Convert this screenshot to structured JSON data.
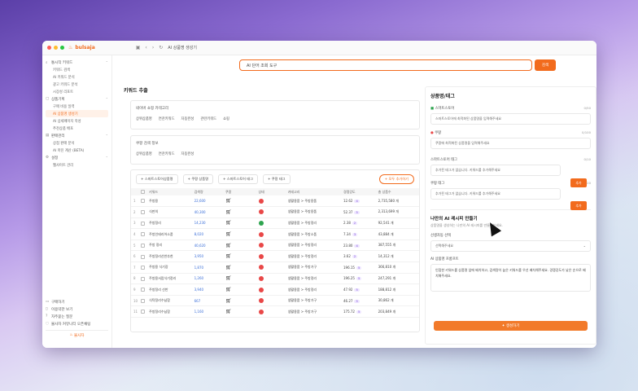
{
  "window": {
    "logo": "bulsaja",
    "tab_title": "AI 상품명 생성기"
  },
  "sidebar": {
    "sections": [
      {
        "label": "통시작 키워드",
        "items": [
          "키워드 검색",
          "AI 키워드 분석",
          "광고 키워드 분석",
          "시장성 리포트"
        ]
      },
      {
        "label": "상품기획",
        "items": [
          "구매 비용 일력",
          "AI 상품명 생성기",
          "AI 상세페이지 작성",
          "추천상품 배포"
        ]
      },
      {
        "label": "판매관리",
        "items": [
          "상점 판매 분석",
          "AI 마진 계산 (BETA)"
        ]
      },
      {
        "label": "설정",
        "items": [
          "웹사이트 관리"
        ]
      }
    ],
    "active_item": "AI 상품명 생성기",
    "bottom_items": [
      "구매하기",
      "이용약관 보기",
      "자주묻는 질문",
      "불사자 커뮤니티 오픈채팅"
    ],
    "brand": "불사자"
  },
  "search": {
    "value": "AI 단어 조회 도구",
    "button": "검색"
  },
  "left": {
    "title": "키워드 추출",
    "card1": {
      "label": "네이버 쇼핑 카테고리",
      "chips": [
        "상위상품명",
        "연관키워드",
        "자동완성",
        "관련키워드",
        "쇼핑"
      ]
    },
    "card2": {
      "label": "쿠팡 검색 정보",
      "chips": [
        "상위상품명",
        "연관키워드",
        "자동완성"
      ]
    },
    "actions": [
      "+ 스마트스토어상품명",
      "+ 쿠팡 상품명",
      "+ 스마트스토어 태그",
      "+ 쿠팡 태그"
    ],
    "apply_button": "+ 모두 추가하기",
    "columns": [
      "키워드",
      "검색량",
      "쿠팡",
      "상태",
      "카테고리",
      "경쟁강도",
      "총 상품수"
    ],
    "rows": [
      {
        "num": "1",
        "keyword": "주방용",
        "volume": "22,600",
        "cat": "생활용품 > 주방용품",
        "comp": "12.62",
        "level": "4",
        "total": "2,735,580 개",
        "ok": false
      },
      {
        "num": "2",
        "keyword": "식판의",
        "volume": "40,300",
        "cat": "생활용품 > 주방용품",
        "comp": "52.37",
        "level": "5",
        "total": "2,313,699 개",
        "ok": false
      },
      {
        "num": "3",
        "keyword": "주방정리",
        "volume": "14,230",
        "cat": "생활용품 > 주방정리",
        "comp": "2.38",
        "level": "2",
        "total": "92,541 개",
        "ok": true
      },
      {
        "num": "4",
        "keyword": "주방인테리어소품",
        "volume": "8,020",
        "cat": "생활용품 > 주방소품",
        "comp": "7.34",
        "level": "3",
        "total": "43,884 개",
        "ok": false
      },
      {
        "num": "5",
        "keyword": "주방 정리",
        "volume": "40,620",
        "cat": "생활용품 > 주방정리",
        "comp": "23.80",
        "level": "4",
        "total": "387,555 개",
        "ok": false
      },
      {
        "num": "6",
        "keyword": "주방정리선반추천",
        "volume": "3,950",
        "cat": "생활용품 > 주방정리",
        "comp": "3.62",
        "level": "2",
        "total": "14,312 개",
        "ok": false
      },
      {
        "num": "7",
        "keyword": "주방용 식기장",
        "volume": "1,870",
        "cat": "생활용품 > 주방가구",
        "comp": "196.15",
        "level": "5",
        "total": "366,810 개",
        "ok": false
      },
      {
        "num": "8",
        "keyword": "주방용서랍식기정리",
        "volume": "1,260",
        "cat": "생활용품 > 주방정리",
        "comp": "196.25",
        "level": "5",
        "total": "247,291 개",
        "ok": false
      },
      {
        "num": "9",
        "keyword": "주방정리 선반",
        "volume": "3,940",
        "cat": "생활용품 > 주방정리",
        "comp": "47.92",
        "level": "5",
        "total": "188,812 개",
        "ok": false
      },
      {
        "num": "10",
        "keyword": "식탁정리수납함",
        "volume": "667",
        "cat": "생활용품 > 주방가구",
        "comp": "46.27",
        "level": "5",
        "total": "30,862 개",
        "ok": false
      },
      {
        "num": "11",
        "keyword": "주방정리수납함",
        "volume": "1,160",
        "cat": "생활용품 > 주방가구",
        "comp": "175.72",
        "level": "5",
        "total": "203,849 개",
        "ok": false
      }
    ]
  },
  "right": {
    "title": "상품명/태그",
    "smartstore_label": "스마트스토어",
    "smartstore_hint": "스마트스토어에 최적화된 상품명을 입력해주세요",
    "smartstore_count": "0/50",
    "coupang_label": "쿠팡",
    "coupang_hint": "쿠팡에 최적화된 상품명을 입력해주세요",
    "coupang_count": "0/100",
    "ss_tag_label": "스마트스토어 태그",
    "ss_tag_hint": "추가된 태그가 없습니다. 키워드를 추가해주세요",
    "ss_tag_count": "0/10",
    "cp_tag_label": "쿠팡 태그",
    "cp_tag_hint": "추가된 태그가 없습니다. 키워드를 추가해주세요",
    "cp_tag_count": "0/20",
    "add_label": "추가",
    "ai_title": "나만의 AI 레시피 만들기",
    "ai_desc": "상품명을 생성하는 나만의 AI 레시피를 만들어보세요.",
    "select_label": "선생자동 선택",
    "select_placeholder": "선택해주세요",
    "prompt_label": "AI 상품명 프롬프트",
    "prompt_text": "인접한 키워드를 상품명 앞에 배치하고, 검색량이 높은 키워드를 우선 배치해주세요. 경쟁강도가 낮은 순으로 배치해주세요.",
    "generate_button": "생성하기"
  }
}
